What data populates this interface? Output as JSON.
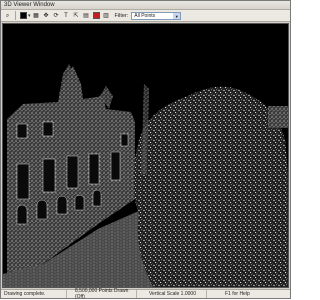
{
  "window": {
    "title": "3D Viewer Window"
  },
  "toolbar": {
    "filter_label": "Filter:",
    "filter_value": "All Points",
    "icons": [
      "zoom-icon",
      "color-icon",
      "select-icon",
      "pan-icon",
      "rotate-icon",
      "text-tool-icon",
      "move-icon",
      "measure-icon",
      "background-color-icon",
      "filter-icon"
    ]
  },
  "status": {
    "message": "Drawing complete.",
    "points": "8,500,000 Points Drawn (Off)",
    "vertical_scale": "Vertical Scale 1.0000",
    "help": "F1 for Help"
  },
  "colors": {
    "accent_red": "#c41e1e",
    "viewport_bg": "#000000"
  }
}
